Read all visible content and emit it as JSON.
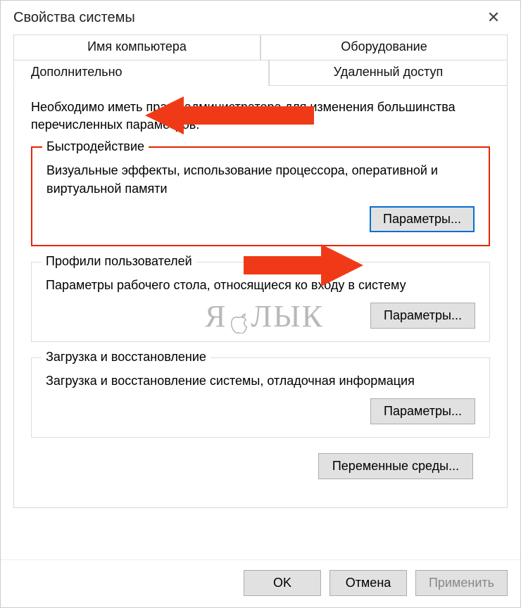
{
  "window": {
    "title": "Свойства системы"
  },
  "tabs": {
    "row1": [
      "Имя компьютера",
      "Оборудование"
    ],
    "row2": [
      "Дополнительно",
      "Удаленный доступ"
    ]
  },
  "admin_note": "Необходимо иметь права администратора для изменения большинства перечисленных параметров.",
  "groups": {
    "performance": {
      "legend": "Быстродействие",
      "desc": "Визуальные эффекты, использование процессора, оперативной и виртуальной памяти",
      "button": "Параметры..."
    },
    "profiles": {
      "legend": "Профили пользователей",
      "desc": "Параметры рабочего стола, относящиеся ко входу в систему",
      "button": "Параметры..."
    },
    "startup": {
      "legend": "Загрузка и восстановление",
      "desc": "Загрузка и восстановление системы, отладочная информация",
      "button": "Параметры..."
    }
  },
  "env_button": "Переменные среды...",
  "footer": {
    "ok": "OK",
    "cancel": "Отмена",
    "apply": "Применить"
  },
  "watermark": {
    "pre": "Я",
    "post": "ЛЫК"
  }
}
